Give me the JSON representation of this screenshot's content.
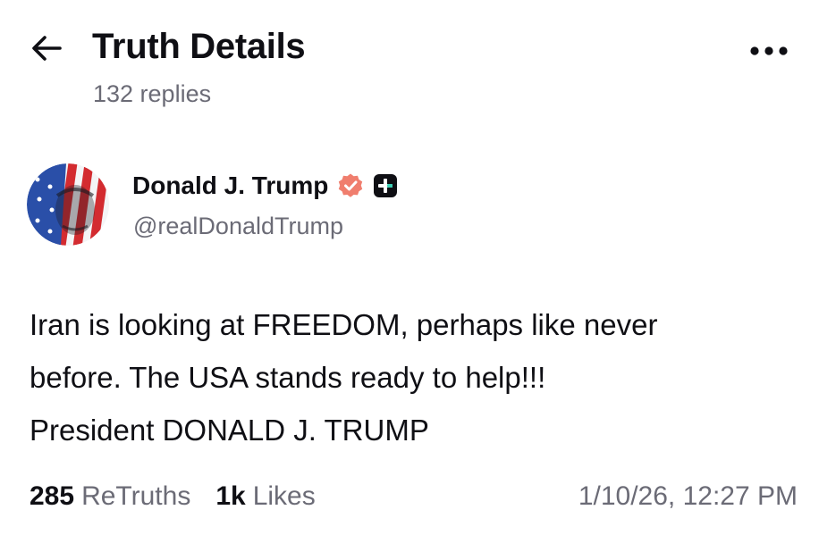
{
  "header": {
    "title": "Truth Details",
    "reply_count": "132 replies",
    "back_icon": "arrow-left-icon",
    "more_icon": "more-horizontal-icon"
  },
  "author": {
    "name": "Donald J. Trump",
    "handle": "@realDonaldTrump",
    "verified_icon": "verified-badge-icon",
    "verified_color": "#f07e6e",
    "plus_icon": "truth-plus-icon"
  },
  "post": {
    "lines": [
      "Iran is looking at FREEDOM, perhaps like never",
      "before. The USA stands ready to help!!!",
      "President DONALD J. TRUMP"
    ]
  },
  "stats": {
    "retruths_count": "285",
    "retruths_label": "ReTruths",
    "likes_count": "1k",
    "likes_label": "Likes",
    "timestamp": "1/10/26, 12:27 PM"
  },
  "colors": {
    "text": "#0f0f14",
    "muted": "#6b6b76",
    "background": "#ffffff",
    "accent": "#5448ee"
  }
}
